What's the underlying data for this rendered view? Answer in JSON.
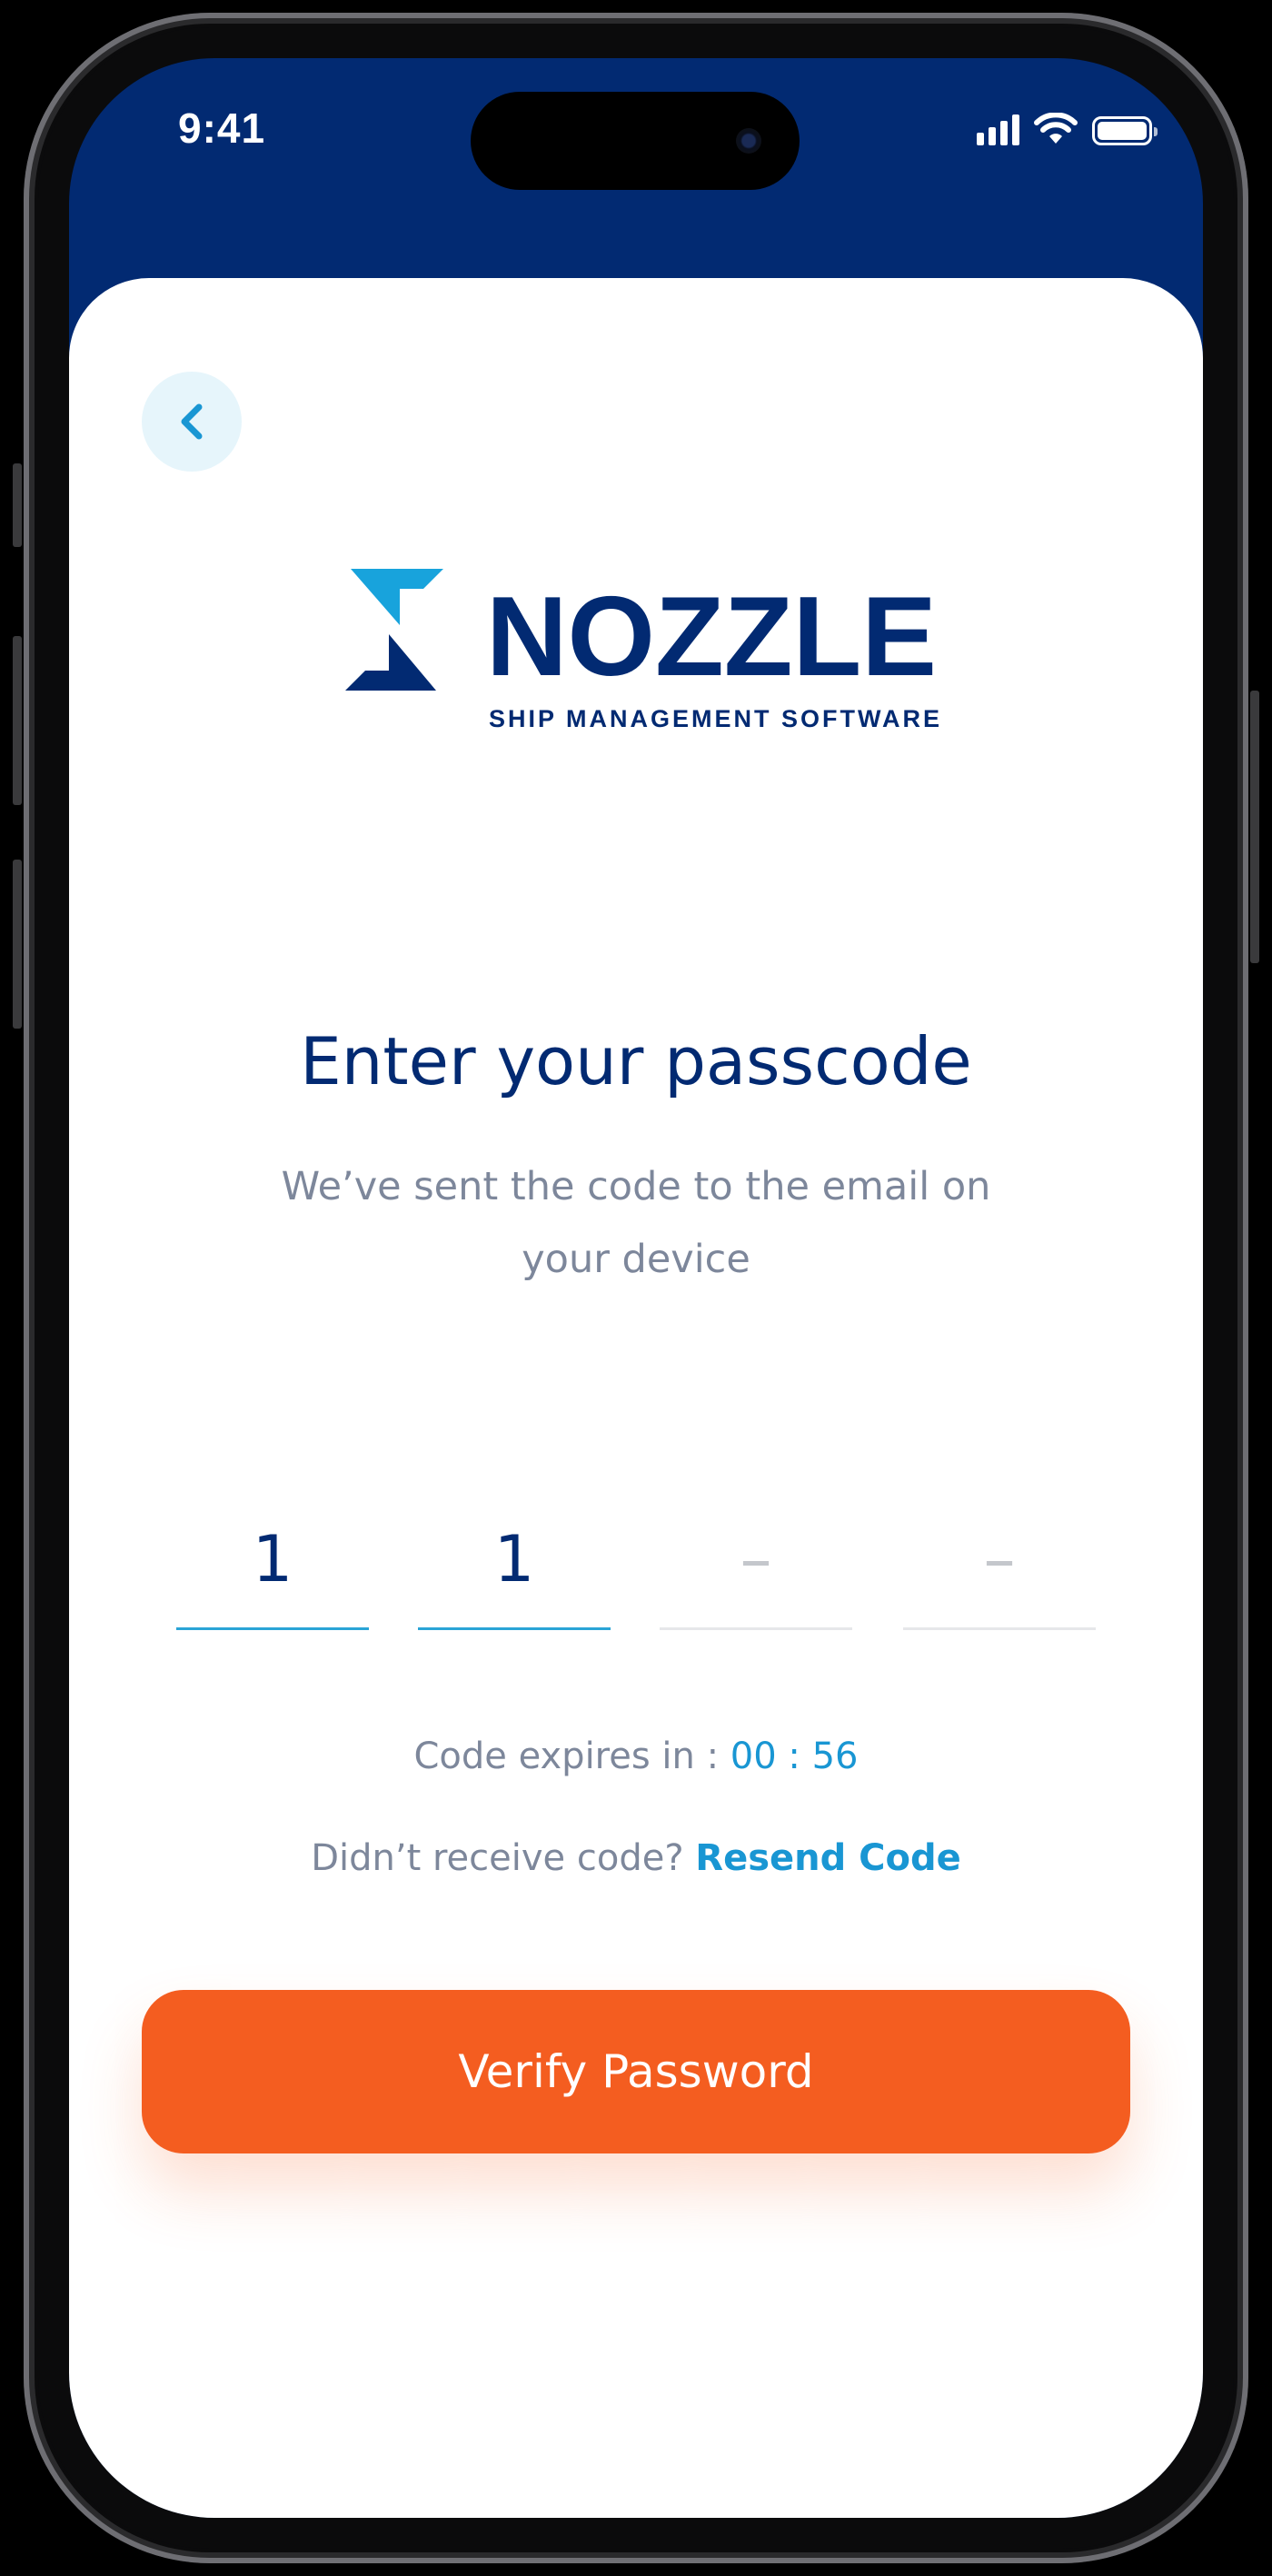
{
  "status_bar": {
    "time": "9:41",
    "icons": [
      "cellular-signal-icon",
      "wifi-icon",
      "battery-icon"
    ]
  },
  "nav": {
    "back_icon": "chevron-left-icon"
  },
  "brand": {
    "name": "NOZZLE",
    "tagline": "SHIP MANAGEMENT SOFTWARE",
    "logo_icon": "nozzle-logo-icon"
  },
  "passcode": {
    "title": "Enter your passcode",
    "subtitle": "We’ve sent the code to the email on your device",
    "digits": [
      "1",
      "1",
      "–",
      "–"
    ],
    "expires_label": "Code expires in :",
    "expires_timer": "00 : 56",
    "resend_prompt": "Didn’t receive code?",
    "resend_link": "Resend Code",
    "verify_label": "Verify Password"
  },
  "colors": {
    "brand_navy": "#022a72",
    "brand_cyan": "#1996d3",
    "accent_orange": "#f45d20",
    "muted_text": "#7d879b"
  }
}
